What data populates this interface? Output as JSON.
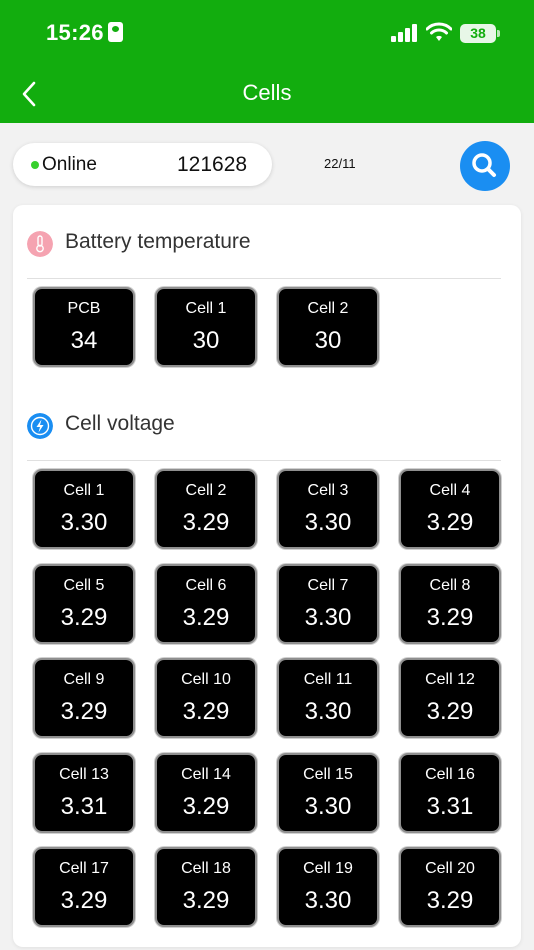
{
  "status": {
    "time": "15:26",
    "battery": "38"
  },
  "nav": {
    "title": "Cells"
  },
  "device": {
    "online": "Online",
    "id": "121628",
    "date": "22/11"
  },
  "temperature": {
    "title": "Battery temperature",
    "items": [
      {
        "label": "PCB",
        "value": "34"
      },
      {
        "label": "Cell 1",
        "value": "30"
      },
      {
        "label": "Cell 2",
        "value": "30"
      }
    ]
  },
  "voltage": {
    "title": "Cell voltage",
    "items": [
      {
        "label": "Cell 1",
        "value": "3.30"
      },
      {
        "label": "Cell 2",
        "value": "3.29"
      },
      {
        "label": "Cell 3",
        "value": "3.30"
      },
      {
        "label": "Cell 4",
        "value": "3.29"
      },
      {
        "label": "Cell 5",
        "value": "3.29"
      },
      {
        "label": "Cell 6",
        "value": "3.29"
      },
      {
        "label": "Cell 7",
        "value": "3.30"
      },
      {
        "label": "Cell 8",
        "value": "3.29"
      },
      {
        "label": "Cell 9",
        "value": "3.29"
      },
      {
        "label": "Cell 10",
        "value": "3.29"
      },
      {
        "label": "Cell 11",
        "value": "3.30"
      },
      {
        "label": "Cell 12",
        "value": "3.29"
      },
      {
        "label": "Cell 13",
        "value": "3.31"
      },
      {
        "label": "Cell 14",
        "value": "3.29"
      },
      {
        "label": "Cell 15",
        "value": "3.30"
      },
      {
        "label": "Cell 16",
        "value": "3.31"
      },
      {
        "label": "Cell 17",
        "value": "3.29"
      },
      {
        "label": "Cell 18",
        "value": "3.29"
      },
      {
        "label": "Cell 19",
        "value": "3.30"
      },
      {
        "label": "Cell 20",
        "value": "3.29"
      }
    ]
  },
  "colors": {
    "header": "#12ad0e",
    "online": "#37d02d",
    "search": "#1a8ef2",
    "thermo": "#f5a3b1",
    "bolt": "#1a8ef2"
  },
  "icons": {
    "back": "chevron-left-icon",
    "search": "search-icon",
    "temperature": "thermometer-icon",
    "voltage": "lightning-icon"
  }
}
